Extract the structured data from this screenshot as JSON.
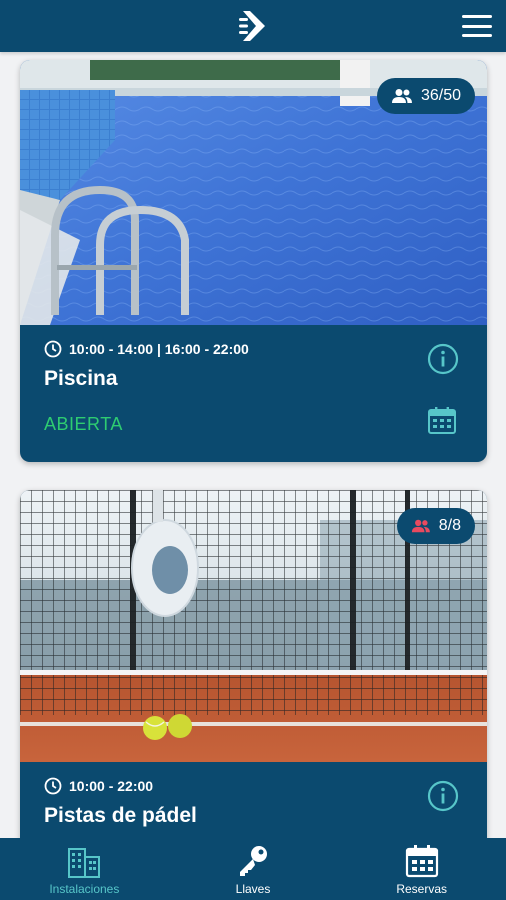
{
  "header": {
    "logo_icon": "logo-arrow-icon",
    "menu_icon": "hamburger-icon"
  },
  "facilities": [
    {
      "capacity": "36/50",
      "capacity_icon": "users-icon",
      "hours": "10:00 - 14:00 | 16:00 - 22:00",
      "name": "Piscina",
      "status": "ABIERTA",
      "status_color": "#2ecc71"
    },
    {
      "capacity": "8/8",
      "capacity_icon": "users-full-icon",
      "capacity_icon_color": "#e84a5f",
      "hours": "10:00 - 22:00",
      "name": "Pistas de pádel"
    }
  ],
  "bottom_nav": {
    "active": "Instalaciones",
    "tabs": [
      {
        "label": "Instalaciones",
        "icon": "buildings-icon"
      },
      {
        "label": "Llaves",
        "icon": "key-icon"
      },
      {
        "label": "Reservas",
        "icon": "calendar-icon"
      }
    ]
  },
  "colors": {
    "primary": "#0b4a6f",
    "accent": "#57c6c9",
    "open": "#2ecc71"
  }
}
